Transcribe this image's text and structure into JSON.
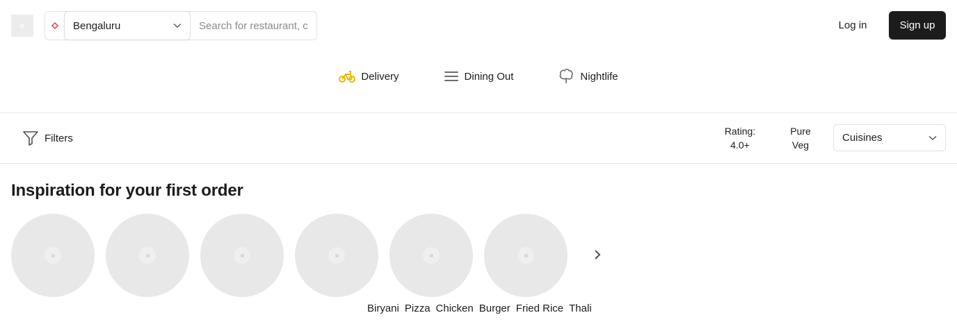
{
  "header": {
    "location": "Bengaluru",
    "search_placeholder": "Search for restaurant, cuisine or a dish",
    "login_label": "Log in",
    "signup_label": "Sign up"
  },
  "tabs": [
    {
      "label": "Delivery",
      "icon": "scooter-icon",
      "color": "#e6b800"
    },
    {
      "label": "Dining Out",
      "icon": "menu-icon"
    },
    {
      "label": "Nightlife",
      "icon": "tree-icon"
    }
  ],
  "filters": {
    "filters_label": "Filters",
    "rating_line1": "Rating:",
    "rating_line2": "4.0+",
    "pureveg_line1": "Pure",
    "pureveg_line2": "Veg",
    "cuisines_label": "Cuisines"
  },
  "section": {
    "title": "Inspiration for your first order",
    "dishes": [
      "Biryani",
      "Pizza",
      "Chicken",
      "Burger",
      "Fried Rice",
      "Thali"
    ]
  },
  "colors": {
    "primary_button": "#1c1c1c",
    "placeholder_circle": "#e8e8e8",
    "location_pin": "#e23744"
  }
}
